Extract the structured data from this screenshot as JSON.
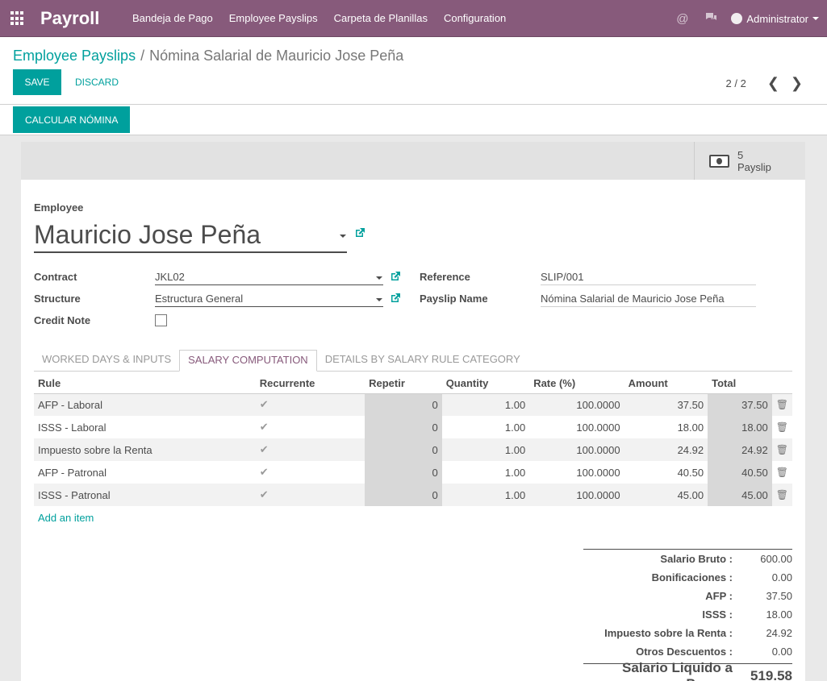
{
  "navbar": {
    "brand": "Payroll",
    "menu": [
      "Bandeja de Pago",
      "Employee Payslips",
      "Carpeta de Planillas",
      "Configuration"
    ],
    "user": "Administrator",
    "icons": [
      "apps-grid-icon",
      "at-sign-icon",
      "chat-icon"
    ]
  },
  "breadcrumb": {
    "parent": "Employee Payslips",
    "separator": "/",
    "current": "Nómina Salarial de Mauricio Jose Peña"
  },
  "actions": {
    "save": "SAVE",
    "discard": "DISCARD",
    "calcular": "CALCULAR NÓMINA"
  },
  "pager": {
    "value": "2 / 2",
    "prev": "❮",
    "next": "❯"
  },
  "stat_button": {
    "count": "5",
    "label": "Payslip"
  },
  "form": {
    "employee_label": "Employee",
    "employee": "Mauricio Jose Peña",
    "contract_label": "Contract",
    "contract": "JKL02",
    "structure_label": "Structure",
    "structure": "Estructura General",
    "credit_note_label": "Credit Note",
    "credit_note": false,
    "reference_label": "Reference",
    "reference": "SLIP/001",
    "payslip_name_label": "Payslip Name",
    "payslip_name": "Nómina Salarial de Mauricio Jose Peña"
  },
  "tabs": [
    "WORKED DAYS & INPUTS",
    "SALARY COMPUTATION",
    "DETAILS BY SALARY RULE CATEGORY"
  ],
  "active_tab": "SALARY COMPUTATION",
  "table": {
    "headers": [
      "Rule",
      "Recurrente",
      "Repetir",
      "Quantity",
      "Rate (%)",
      "Amount",
      "Total"
    ],
    "rows": [
      {
        "rule": "AFP - Laboral",
        "recurrente": true,
        "repetir": "0",
        "quantity": "1.00",
        "rate": "100.0000",
        "amount": "37.50",
        "total": "37.50"
      },
      {
        "rule": "ISSS - Laboral",
        "recurrente": true,
        "repetir": "0",
        "quantity": "1.00",
        "rate": "100.0000",
        "amount": "18.00",
        "total": "18.00"
      },
      {
        "rule": "Impuesto sobre la Renta",
        "recurrente": true,
        "repetir": "0",
        "quantity": "1.00",
        "rate": "100.0000",
        "amount": "24.92",
        "total": "24.92"
      },
      {
        "rule": "AFP - Patronal",
        "recurrente": true,
        "repetir": "0",
        "quantity": "1.00",
        "rate": "100.0000",
        "amount": "40.50",
        "total": "40.50"
      },
      {
        "rule": "ISSS - Patronal",
        "recurrente": true,
        "repetir": "0",
        "quantity": "1.00",
        "rate": "100.0000",
        "amount": "45.00",
        "total": "45.00"
      }
    ],
    "add_item": "Add an item"
  },
  "totals": [
    {
      "label": "Salario Bruto :",
      "value": "600.00"
    },
    {
      "label": "Bonificaciones :",
      "value": "0.00"
    },
    {
      "label": "AFP :",
      "value": "37.50"
    },
    {
      "label": "ISSS :",
      "value": "18.00"
    },
    {
      "label": "Impuesto sobre la Renta :",
      "value": "24.92"
    },
    {
      "label": "Otros Descuentos :",
      "value": "0.00"
    }
  ],
  "final_total": {
    "label": "Salario Liquido a Pagar :",
    "value": "519.58"
  },
  "colors": {
    "brand": "#875a7b",
    "accent": "#00a09d"
  }
}
